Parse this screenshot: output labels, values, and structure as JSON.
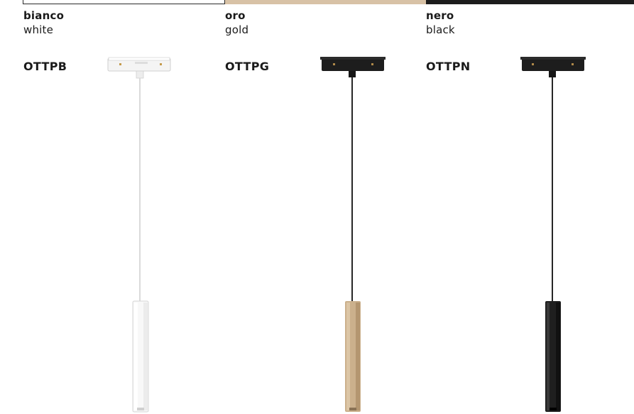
{
  "swatches": [
    {
      "name": "white",
      "color": "#ffffff"
    },
    {
      "name": "gold",
      "color": "#d8c2a6"
    },
    {
      "name": "black",
      "color": "#1c1c1c"
    }
  ],
  "variants": [
    {
      "name_it": "bianco",
      "name_en": "white",
      "code": "OTTPB",
      "body_color": "#f7f7f7",
      "cable_color": "#e6e6e6"
    },
    {
      "name_it": "oro",
      "name_en": "gold",
      "code": "OTTPG",
      "body_color": "#cbb08c",
      "cable_color": "#222222"
    },
    {
      "name_it": "nero",
      "name_en": "black",
      "code": "OTTPN",
      "body_color": "#1f1f1f",
      "cable_color": "#222222"
    }
  ]
}
